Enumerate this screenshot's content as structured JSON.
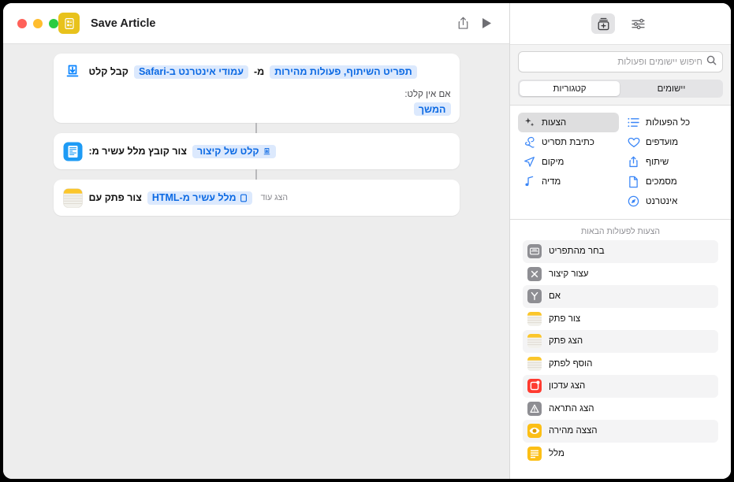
{
  "window": {
    "title": "Save Article",
    "traffic_lights": [
      "close",
      "minimize",
      "zoom"
    ]
  },
  "sidebar": {
    "toolbar": {
      "filter_icon": "sliders-icon",
      "add_action_icon": "add-action-icon"
    },
    "search": {
      "placeholder": "חיפוש יישומים ופעולות",
      "value": "",
      "icon": "search-icon"
    },
    "segmented": {
      "options": [
        {
          "label": "קטגוריות",
          "selected": true
        },
        {
          "label": "יישומים",
          "selected": false
        }
      ]
    },
    "categories": [
      {
        "label": "כל הפעולות",
        "icon": "list-icon",
        "selected": false,
        "col": "right"
      },
      {
        "label": "הצעות",
        "icon": "sparkles-icon",
        "selected": true,
        "col": "left"
      },
      {
        "label": "מועדפים",
        "icon": "heart-icon",
        "selected": false,
        "col": "right"
      },
      {
        "label": "כתיבת תסריט",
        "icon": "script-icon",
        "selected": false,
        "col": "left"
      },
      {
        "label": "שיתוף",
        "icon": "share-icon",
        "selected": false,
        "col": "right"
      },
      {
        "label": "מיקום",
        "icon": "location-icon",
        "selected": false,
        "col": "left"
      },
      {
        "label": "מסמכים",
        "icon": "document-icon",
        "selected": false,
        "col": "right"
      },
      {
        "label": "מדיה",
        "icon": "music-note-icon",
        "selected": false,
        "col": "left"
      },
      {
        "label": "אינטרנט",
        "icon": "compass-icon",
        "selected": false,
        "col": "right"
      },
      {
        "label": "",
        "icon": "",
        "selected": false,
        "col": "left"
      }
    ],
    "suggestions_title": "הצעות לפעולות הבאות",
    "suggestions": [
      {
        "label": "בחר מהתפריט",
        "icon": "menu-select-icon"
      },
      {
        "label": "עצור קיצור",
        "icon": "stop-shortcut-icon"
      },
      {
        "label": "אם",
        "icon": "if-branch-icon"
      },
      {
        "label": "צור פתק",
        "icon": "notes-icon"
      },
      {
        "label": "הצג פתק",
        "icon": "notes-icon"
      },
      {
        "label": "הוסף לפתק",
        "icon": "notes-icon"
      },
      {
        "label": "הצג עדכון",
        "icon": "reminders-icon"
      },
      {
        "label": "הצג התראה",
        "icon": "alert-icon"
      },
      {
        "label": "הצצה מהירה",
        "icon": "quick-look-icon"
      },
      {
        "label": "מלל",
        "icon": "text-icon"
      }
    ]
  },
  "main": {
    "toolbar": {
      "run_label": "run",
      "run_icon": "play-icon",
      "share_icon": "share-icon",
      "doc_icon": "shortcut-glyph-icon"
    },
    "cards": [
      {
        "id": "receive-input",
        "icon": "receive-input-icon",
        "segments": [
          {
            "type": "text",
            "value": "קבל קלט"
          },
          {
            "type": "token",
            "value": "עמודי אינטרנט ב-Safari"
          },
          {
            "type": "text",
            "value": "מ-"
          },
          {
            "type": "token",
            "value": "תפריט השיתוף, פעולות מהירות"
          }
        ],
        "sub_label": "אם אין קלט:",
        "sub_token": "המשך"
      },
      {
        "id": "make-rich-text",
        "icon": "rich-text-doc-icon",
        "segments": [
          {
            "type": "text",
            "value": "צור קובץ מלל עשיר מ:"
          },
          {
            "type": "token",
            "value": "קלט של קיצור",
            "token_icon": "input-icon"
          }
        ]
      },
      {
        "id": "create-note",
        "icon": "notes-app-icon",
        "segments": [
          {
            "type": "text",
            "value": "צור פתק עם"
          },
          {
            "type": "token",
            "value": "מלל עשיר מ-HTML",
            "token_icon": "variable-icon"
          }
        ],
        "show_more": "הצג עוד"
      }
    ]
  },
  "colors": {
    "accent_blue": "#0b69e3",
    "token_bg": "#dce9fd",
    "canvas_bg": "#ededed",
    "notes_yellow": "#f5c518",
    "badge_yellow": "#e8c21c"
  }
}
